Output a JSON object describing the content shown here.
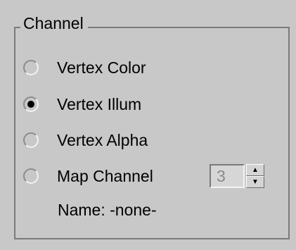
{
  "group": {
    "title": "Channel"
  },
  "options": [
    {
      "label": "Vertex Color",
      "checked": false
    },
    {
      "label": "Vertex Illum",
      "checked": true
    },
    {
      "label": "Vertex Alpha",
      "checked": false
    },
    {
      "label": "Map Channel",
      "checked": false
    }
  ],
  "map_channel": {
    "value": "3",
    "up_icon": "triangle-up-icon",
    "down_icon": "triangle-down-icon"
  },
  "name_line": {
    "label": "Name:",
    "value": "-none-"
  },
  "colors": {
    "background": "#c8c8c8",
    "border": "#7a7a7a",
    "disabled_text": "#8a8a8a"
  }
}
